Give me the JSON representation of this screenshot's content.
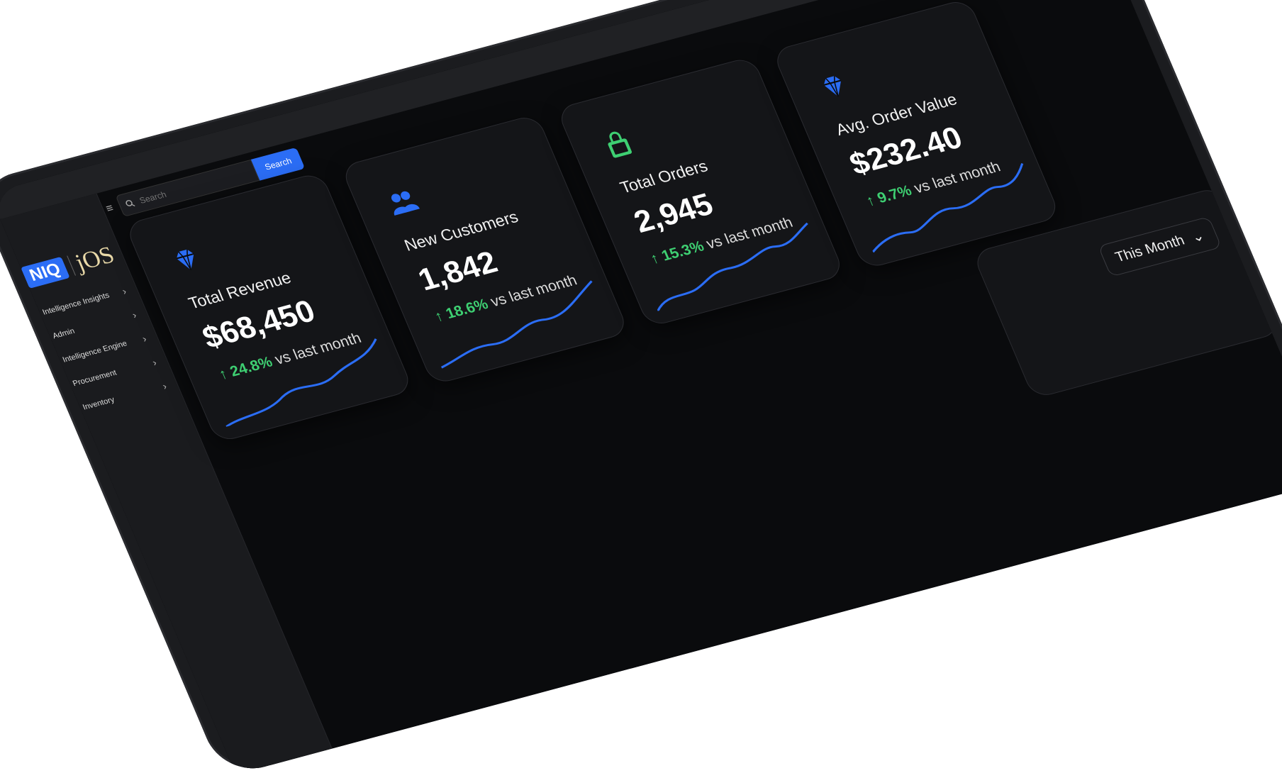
{
  "brand": {
    "niq": "NIQ",
    "jos": "jOS"
  },
  "nav": [
    {
      "label": "Intelligence Insights"
    },
    {
      "label": "Admin"
    },
    {
      "label": "Intelligence Engine"
    },
    {
      "label": "Procurement"
    },
    {
      "label": "Inventory"
    }
  ],
  "search": {
    "placeholder": "Search",
    "button": "Search"
  },
  "cards": [
    {
      "label": "Total Revenue",
      "value": "$68,450",
      "pct": "24.8%",
      "suffix": "vs last month",
      "icon": "diamond-icon",
      "icon_color": "#2b6df5"
    },
    {
      "label": "New Customers",
      "value": "1,842",
      "pct": "18.6%",
      "suffix": "vs last month",
      "icon": "users-icon",
      "icon_color": "#2b6df5"
    },
    {
      "label": "Total Orders",
      "value": "2,945",
      "pct": "15.3%",
      "suffix": "vs last month",
      "icon": "shopping-bag-icon",
      "icon_color": "#3ecf72"
    },
    {
      "label": "Avg. Order Value",
      "value": "$232.40",
      "pct": "9.7%",
      "suffix": "vs last month",
      "icon": "diamond-icon",
      "icon_color": "#2b6df5"
    }
  ],
  "period_dropdown": {
    "label": "This Month"
  },
  "colors": {
    "accent": "#2b6df5",
    "positive": "#3ecf72"
  }
}
